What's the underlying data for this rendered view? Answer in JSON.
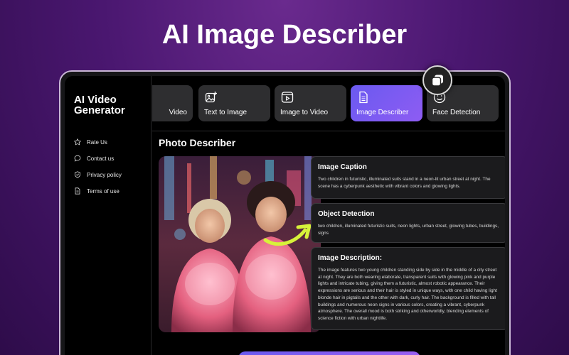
{
  "headline": "AI Image Describer",
  "app": {
    "title": "AI Video Generator"
  },
  "sidebar": {
    "items": [
      {
        "label": "Rate Us",
        "icon": "star-icon"
      },
      {
        "label": "Contact us",
        "icon": "chat-bubble-icon"
      },
      {
        "label": "Privacy policy",
        "icon": "shield-check-icon"
      },
      {
        "label": "Terms of use",
        "icon": "document-icon"
      }
    ]
  },
  "toolbar": {
    "tabs": [
      {
        "label": "Video",
        "icon": "video-icon"
      },
      {
        "label": "Text to Image",
        "icon": "image-plus-icon"
      },
      {
        "label": "Image to Video",
        "icon": "video-play-icon"
      },
      {
        "label": "Image Describer",
        "icon": "document-lines-icon",
        "active": true
      },
      {
        "label": "Face Detection",
        "icon": "smiley-icon"
      }
    ]
  },
  "main": {
    "title": "Photo Describer",
    "cards": [
      {
        "title": "Image Caption",
        "text": "Two children in futuristic, illuminated suits stand in a neon-lit urban street at night. The scene has a cyberpunk aesthetic with vibrant colors and glowing lights."
      },
      {
        "title": "Object Detection",
        "text": "two children, illuminated futuristic suits, neon lights, urban street, glowing tubes, buildings, signs"
      },
      {
        "title": "Image Description:",
        "text": "The image features two young children standing side by side in the middle of a city street at night. They are both wearing elaborate, transparent suits with glowing pink and purple lights and intricate tubing, giving them a futuristic, almost robotic appearance. Their expressions are serious and their hair is styled in unique ways, with one child having light blonde hair in pigtails and the other with dark, curly hair. The background is filled with tall buildings and numerous neon signs in various colors, creating a vibrant, cyberpunk atmosphere. The overall mood is both striking and otherworldly, blending elements of science fiction with urban nightlife."
      }
    ]
  },
  "colors": {
    "background": "#4a1770",
    "accent": "#7a5cf2",
    "card": "#1b1b1d",
    "arrow": "#d7f23a"
  }
}
